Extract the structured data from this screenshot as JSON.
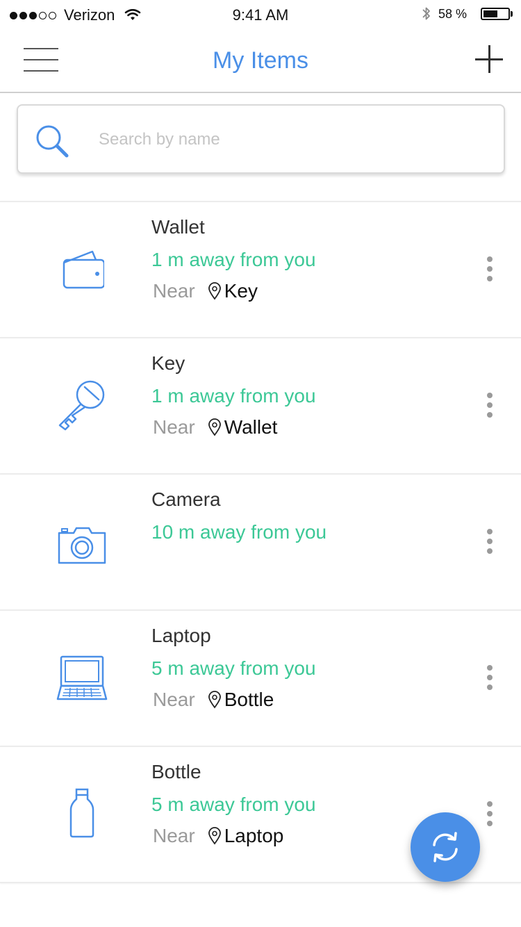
{
  "status_bar": {
    "carrier": "Verizon",
    "time": "9:41 AM",
    "battery_percent": "58 %",
    "battery_level": 0.58,
    "signal_bars_filled": 3,
    "signal_bars_total": 5
  },
  "nav": {
    "title": "My Items",
    "menu_icon": "hamburger-icon",
    "add_icon": "plus-icon"
  },
  "search": {
    "placeholder": "Search by name",
    "value": ""
  },
  "items": [
    {
      "name": "Wallet",
      "distance": "1 m away from you",
      "near_label": "Near",
      "near": "Key",
      "icon": "wallet-icon"
    },
    {
      "name": "Key",
      "distance": "1 m away from you",
      "near_label": "Near",
      "near": "Wallet",
      "icon": "key-icon"
    },
    {
      "name": "Camera",
      "distance": "10 m away from you",
      "near_label": "",
      "near": "",
      "icon": "camera-icon"
    },
    {
      "name": "Laptop",
      "distance": "5 m away from you",
      "near_label": "Near",
      "near": "Bottle",
      "icon": "laptop-icon"
    },
    {
      "name": "Bottle",
      "distance": "5 m away from you",
      "near_label": "Near",
      "near": "Laptop",
      "icon": "bottle-icon"
    }
  ],
  "colors": {
    "accent": "#4a8fe7",
    "distance": "#3cc896",
    "muted": "#9a9a9a"
  },
  "fab": {
    "icon": "refresh-icon"
  }
}
